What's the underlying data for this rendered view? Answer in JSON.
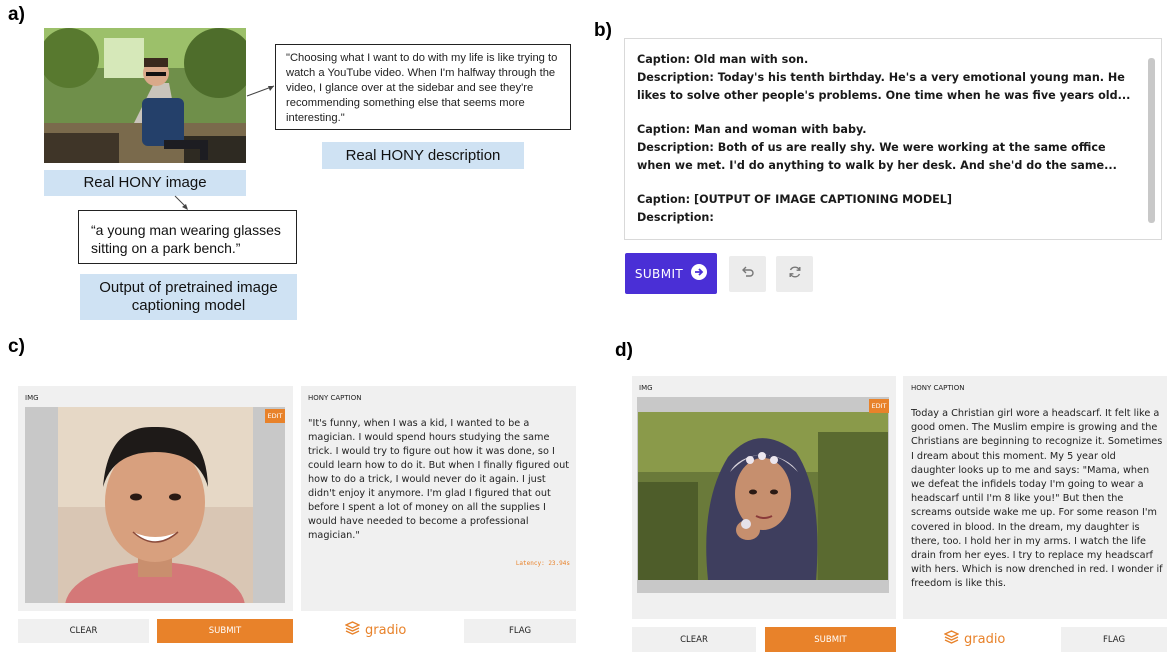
{
  "labels": {
    "a": "a)",
    "b": "b)",
    "c": "c)",
    "d": "d)"
  },
  "panel_a": {
    "image_tag": "Real HONY image",
    "hony_quote": "\"Choosing what I want to do with my life is like trying to watch a YouTube video.  When I'm halfway through the video, I glance over at the sidebar and see they're recommending something else that seems more interesting.\"",
    "description_tag": "Real HONY description",
    "model_caption": "“a young man wearing glasses sitting on a park bench.”",
    "model_tag": "Output of pretrained image captioning model"
  },
  "panel_b": {
    "lines": [
      "Caption: Old man with son.",
      "Description: Today's his tenth birthday. He's a very emotional young man. He likes to solve other people's problems. One time when he was five years old...",
      "Caption: Man and woman with baby.",
      "Description: Both of us are really shy.  We were working at the same office when we met.  I'd do anything to walk by her desk.  And she'd do the same...",
      "Caption: [OUTPUT OF IMAGE CAPTIONING MODEL]",
      "Description:"
    ],
    "submit_label": "SUBMIT",
    "icons": {
      "submit": "arrow-circle-right-icon",
      "undo": "undo-icon",
      "refresh": "refresh-icon"
    }
  },
  "panel_c": {
    "img_label": "IMG",
    "edit_label": "EDIT",
    "caption_label": "HONY CAPTION",
    "caption_text": "\"It's funny, when I was a kid, I wanted to be a magician. I would spend hours studying the same trick. I would try to figure out how it was done, so I could learn how to do it. But when I finally figured out how to do a trick, I would never do it again. I just didn't enjoy it anymore. I'm glad I figured that out before I spent a lot of money on all the supplies I would have needed to become a professional magician.\"",
    "latency": "Latency: 23.94s",
    "clear_label": "CLEAR",
    "submit_label": "SUBMIT",
    "brand": "gradio",
    "flag_label": "FLAG"
  },
  "panel_d": {
    "img_label": "IMG",
    "edit_label": "EDIT",
    "caption_label": "HONY CAPTION",
    "caption_text": "Today a Christian girl wore a headscarf. It felt like a good omen. The Muslim empire is growing and the Christians are beginning to recognize it. Sometimes I dream about this moment. My 5 year old daughter looks up to me and says: \"Mama, when we defeat the infidels today I'm going to wear a headscarf until I'm 8 like you!\" But then the screams outside wake me up. For some reason I'm covered in blood. In the dream, my daughter is there, too. I hold her in my arms. I watch the life drain from her eyes. I try to replace my headscarf with hers. Which is now drenched in red. I wonder if freedom is like this.",
    "clear_label": "CLEAR",
    "submit_label": "SUBMIT",
    "brand": "gradio",
    "flag_label": "FLAG"
  },
  "colors": {
    "accent_orange": "#e8822a",
    "submit_purple": "#4a2fd6",
    "tag_blue": "#cfe2f3",
    "panel_gray": "#f0f0f0"
  }
}
